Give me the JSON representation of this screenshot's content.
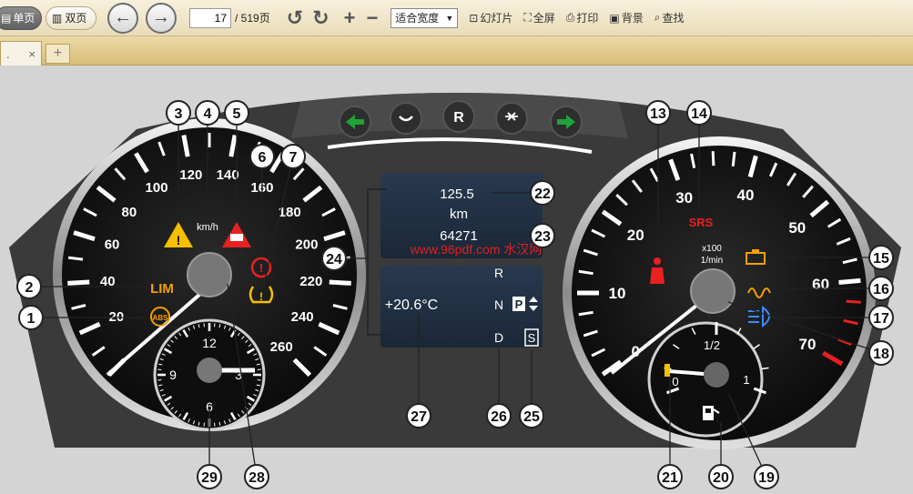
{
  "toolbar": {
    "single_page": "单页",
    "double_page": "双页",
    "current_page": "17",
    "total_pages": "/ 519页",
    "zoom_mode": "适合宽度",
    "slideshow": "幻灯片",
    "fullscreen": "全屏",
    "print": "打印",
    "background": "背景",
    "find": "查找"
  },
  "tabs": {
    "doc_tab": ".",
    "close": "×",
    "add": "+"
  },
  "cluster": {
    "speed_ticks": [
      "20",
      "40",
      "60",
      "80",
      "100",
      "120",
      "140",
      "160",
      "180",
      "200",
      "220",
      "240",
      "260"
    ],
    "speed_unit": "km/h",
    "lim": "LIM",
    "abs": "ABS",
    "rpm_ticks": [
      "0",
      "10",
      "20",
      "30",
      "40",
      "50",
      "60",
      "70"
    ],
    "rpm_unit_1": "x100",
    "rpm_unit_2": "1/min",
    "srs": "SRS",
    "clock_12": "12",
    "clock_9": "9",
    "clock_3": "3",
    "clock_6": "6",
    "fuel_half": "1/2",
    "fuel_0": "0",
    "fuel_1": "1",
    "display_trip": "125.5",
    "display_km": "km",
    "display_total": "64271",
    "display_temp": "+20.6°C",
    "gear_r": "R",
    "gear_n": "N",
    "gear_p": "P",
    "gear_d": "D",
    "gear_s": "S",
    "watermark": "www.96pdf.com 水汉网",
    "top_buttons": [
      "R"
    ],
    "callouts": [
      "1",
      "2",
      "3",
      "4",
      "5",
      "6",
      "7",
      "13",
      "14",
      "15",
      "16",
      "17",
      "18",
      "19",
      "20",
      "21",
      "22",
      "23",
      "24",
      "25",
      "26",
      "27",
      "28",
      "29"
    ]
  }
}
